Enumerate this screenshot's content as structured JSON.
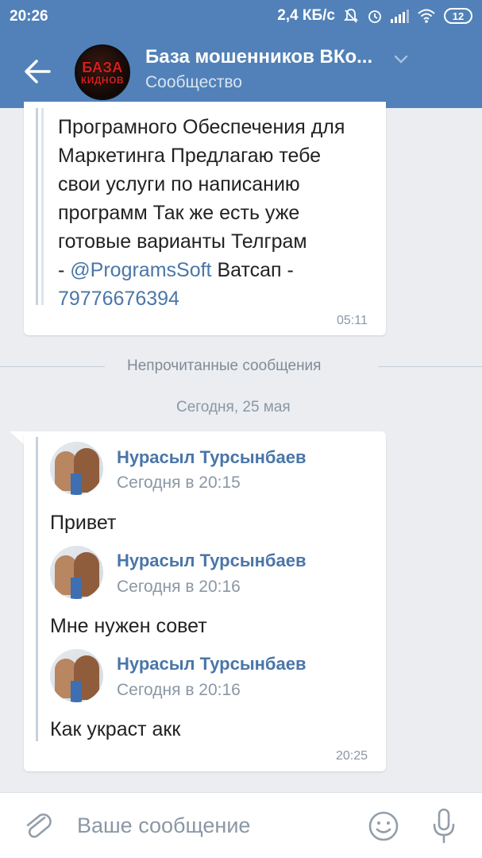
{
  "status_bar": {
    "time": "20:26",
    "network_speed": "2,4 КБ/с",
    "battery": "12"
  },
  "header": {
    "title": "База мошенников ВКо...",
    "subtitle": "Сообщество",
    "avatar_text_line1": "БАЗА",
    "avatar_text_line2": "КИДНОВ"
  },
  "forwarded_message": {
    "lines": [
      "Програмного Обеспечения для",
      "Маркетинга Предлагаю тебе",
      "свои услуги по написанию",
      "программ Так же есть уже",
      "готовые варианты Телграм"
    ],
    "line6_prefix": "- ",
    "line6_link": "@ProgramsSoft",
    "line6_suffix": " Ватсап -",
    "phone_link": "79776676394",
    "time": "05:11"
  },
  "separator": {
    "unread_label": "Непрочитанные сообщения",
    "date_label": "Сегодня, 25 мая"
  },
  "messages": [
    {
      "author": "Нурасыл Турсынбаев",
      "time": "Сегодня в 20:15",
      "text": "Привет"
    },
    {
      "author": "Нурасыл Турсынбаев",
      "time": "Сегодня в 20:16",
      "text": "Мне нужен совет"
    },
    {
      "author": "Нурасыл Турсынбаев",
      "time": "Сегодня в 20:16",
      "text": "Как украст акк"
    }
  ],
  "messages_group_time": "20:25",
  "composer": {
    "placeholder": "Ваше сообщение"
  },
  "colors": {
    "header_bg": "#5181b8",
    "link": "#4a76a8",
    "chat_bg": "#ebedf0"
  },
  "icons": [
    "back-arrow-icon",
    "chevron-down-icon",
    "mute-icon",
    "alarm-icon",
    "signal-icon",
    "wifi-icon",
    "battery-icon",
    "attach-icon",
    "emoji-icon",
    "mic-icon"
  ]
}
